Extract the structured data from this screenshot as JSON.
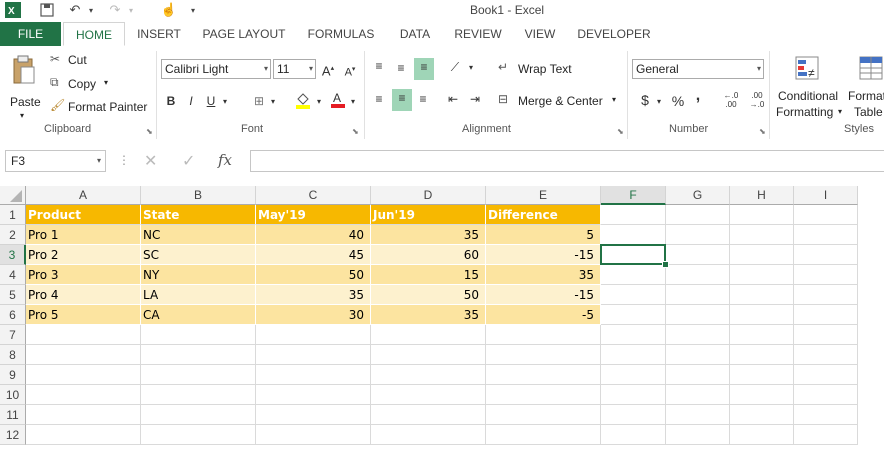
{
  "window": {
    "title": "Book1 - Excel"
  },
  "qat": {
    "icons": [
      "excel-logo-icon",
      "save-icon",
      "undo-icon",
      "redo-icon",
      "touch-mode-icon",
      "customize-qat-icon"
    ]
  },
  "tabs": [
    "FILE",
    "HOME",
    "INSERT",
    "PAGE LAYOUT",
    "FORMULAS",
    "DATA",
    "REVIEW",
    "VIEW",
    "DEVELOPER"
  ],
  "active_tab": "HOME",
  "ribbon": {
    "clipboard": {
      "paste": "Paste",
      "cut": "Cut",
      "copy": "Copy",
      "format_painter": "Format Painter",
      "label": "Clipboard"
    },
    "font": {
      "name": "Calibri Light",
      "size": "11",
      "bold": "B",
      "italic": "I",
      "underline": "U",
      "label": "Font"
    },
    "alignment": {
      "wrap_text": "Wrap Text",
      "merge_center": "Merge & Center",
      "label": "Alignment"
    },
    "number": {
      "format": "General",
      "currency": "$",
      "percent": "%",
      "comma": ",",
      "label": "Number"
    },
    "styles": {
      "conditional_1": "Conditional",
      "conditional_2": "Formatting",
      "format_table_1": "Format as",
      "format_table_2": "Table",
      "label": "Styles"
    }
  },
  "formula_bar": {
    "name_box": "F3",
    "fx": "fx",
    "value": ""
  },
  "columns": [
    "A",
    "B",
    "C",
    "D",
    "E",
    "F",
    "G",
    "H",
    "I"
  ],
  "selected_column": "F",
  "rows": [
    "1",
    "2",
    "3",
    "4",
    "5",
    "6",
    "7",
    "8",
    "9",
    "10",
    "11",
    "12"
  ],
  "selected_row": "3",
  "table": {
    "headers": [
      "Product",
      "State",
      "May'19",
      "Jun'19",
      "Difference"
    ],
    "rows": [
      [
        "Pro 1",
        "NC",
        "40",
        "35",
        "5"
      ],
      [
        "Pro 2",
        "SC",
        "45",
        "60",
        "-15"
      ],
      [
        "Pro 3",
        "NY",
        "50",
        "15",
        "35"
      ],
      [
        "Pro 4",
        "LA",
        "35",
        "50",
        "-15"
      ],
      [
        "Pro 5",
        "CA",
        "30",
        "35",
        "-5"
      ]
    ]
  },
  "colors": {
    "excel_green": "#217346",
    "header_fill": "#f7b800",
    "band_dark": "#fce4a0",
    "band_light": "#fdf1ce"
  }
}
